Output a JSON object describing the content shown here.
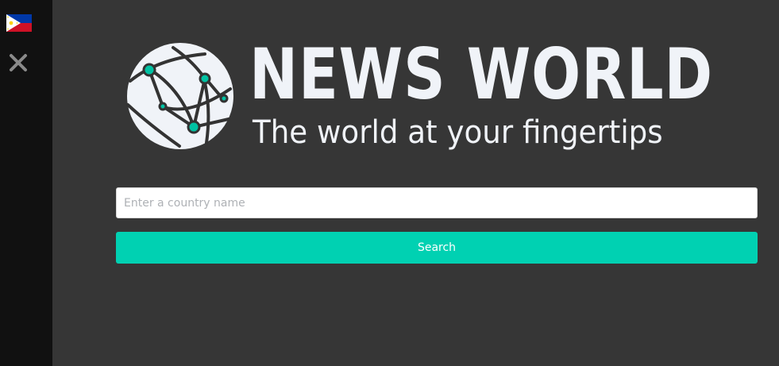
{
  "sidebar": {
    "flag_icon": "philippines-flag-icon",
    "close_icon": "close-icon"
  },
  "brand": {
    "title": "NEWS WORLD",
    "tagline": "The world at your fingertips",
    "globe_icon": "globe-network-icon"
  },
  "search": {
    "placeholder": "Enter a country name",
    "value": "",
    "button_label": "Search"
  },
  "colors": {
    "page_background": "#363636",
    "sidebar_background": "#111111",
    "brand_text": "#f0f3f8",
    "accent": "#00d1b2",
    "input_background": "#ffffff"
  }
}
